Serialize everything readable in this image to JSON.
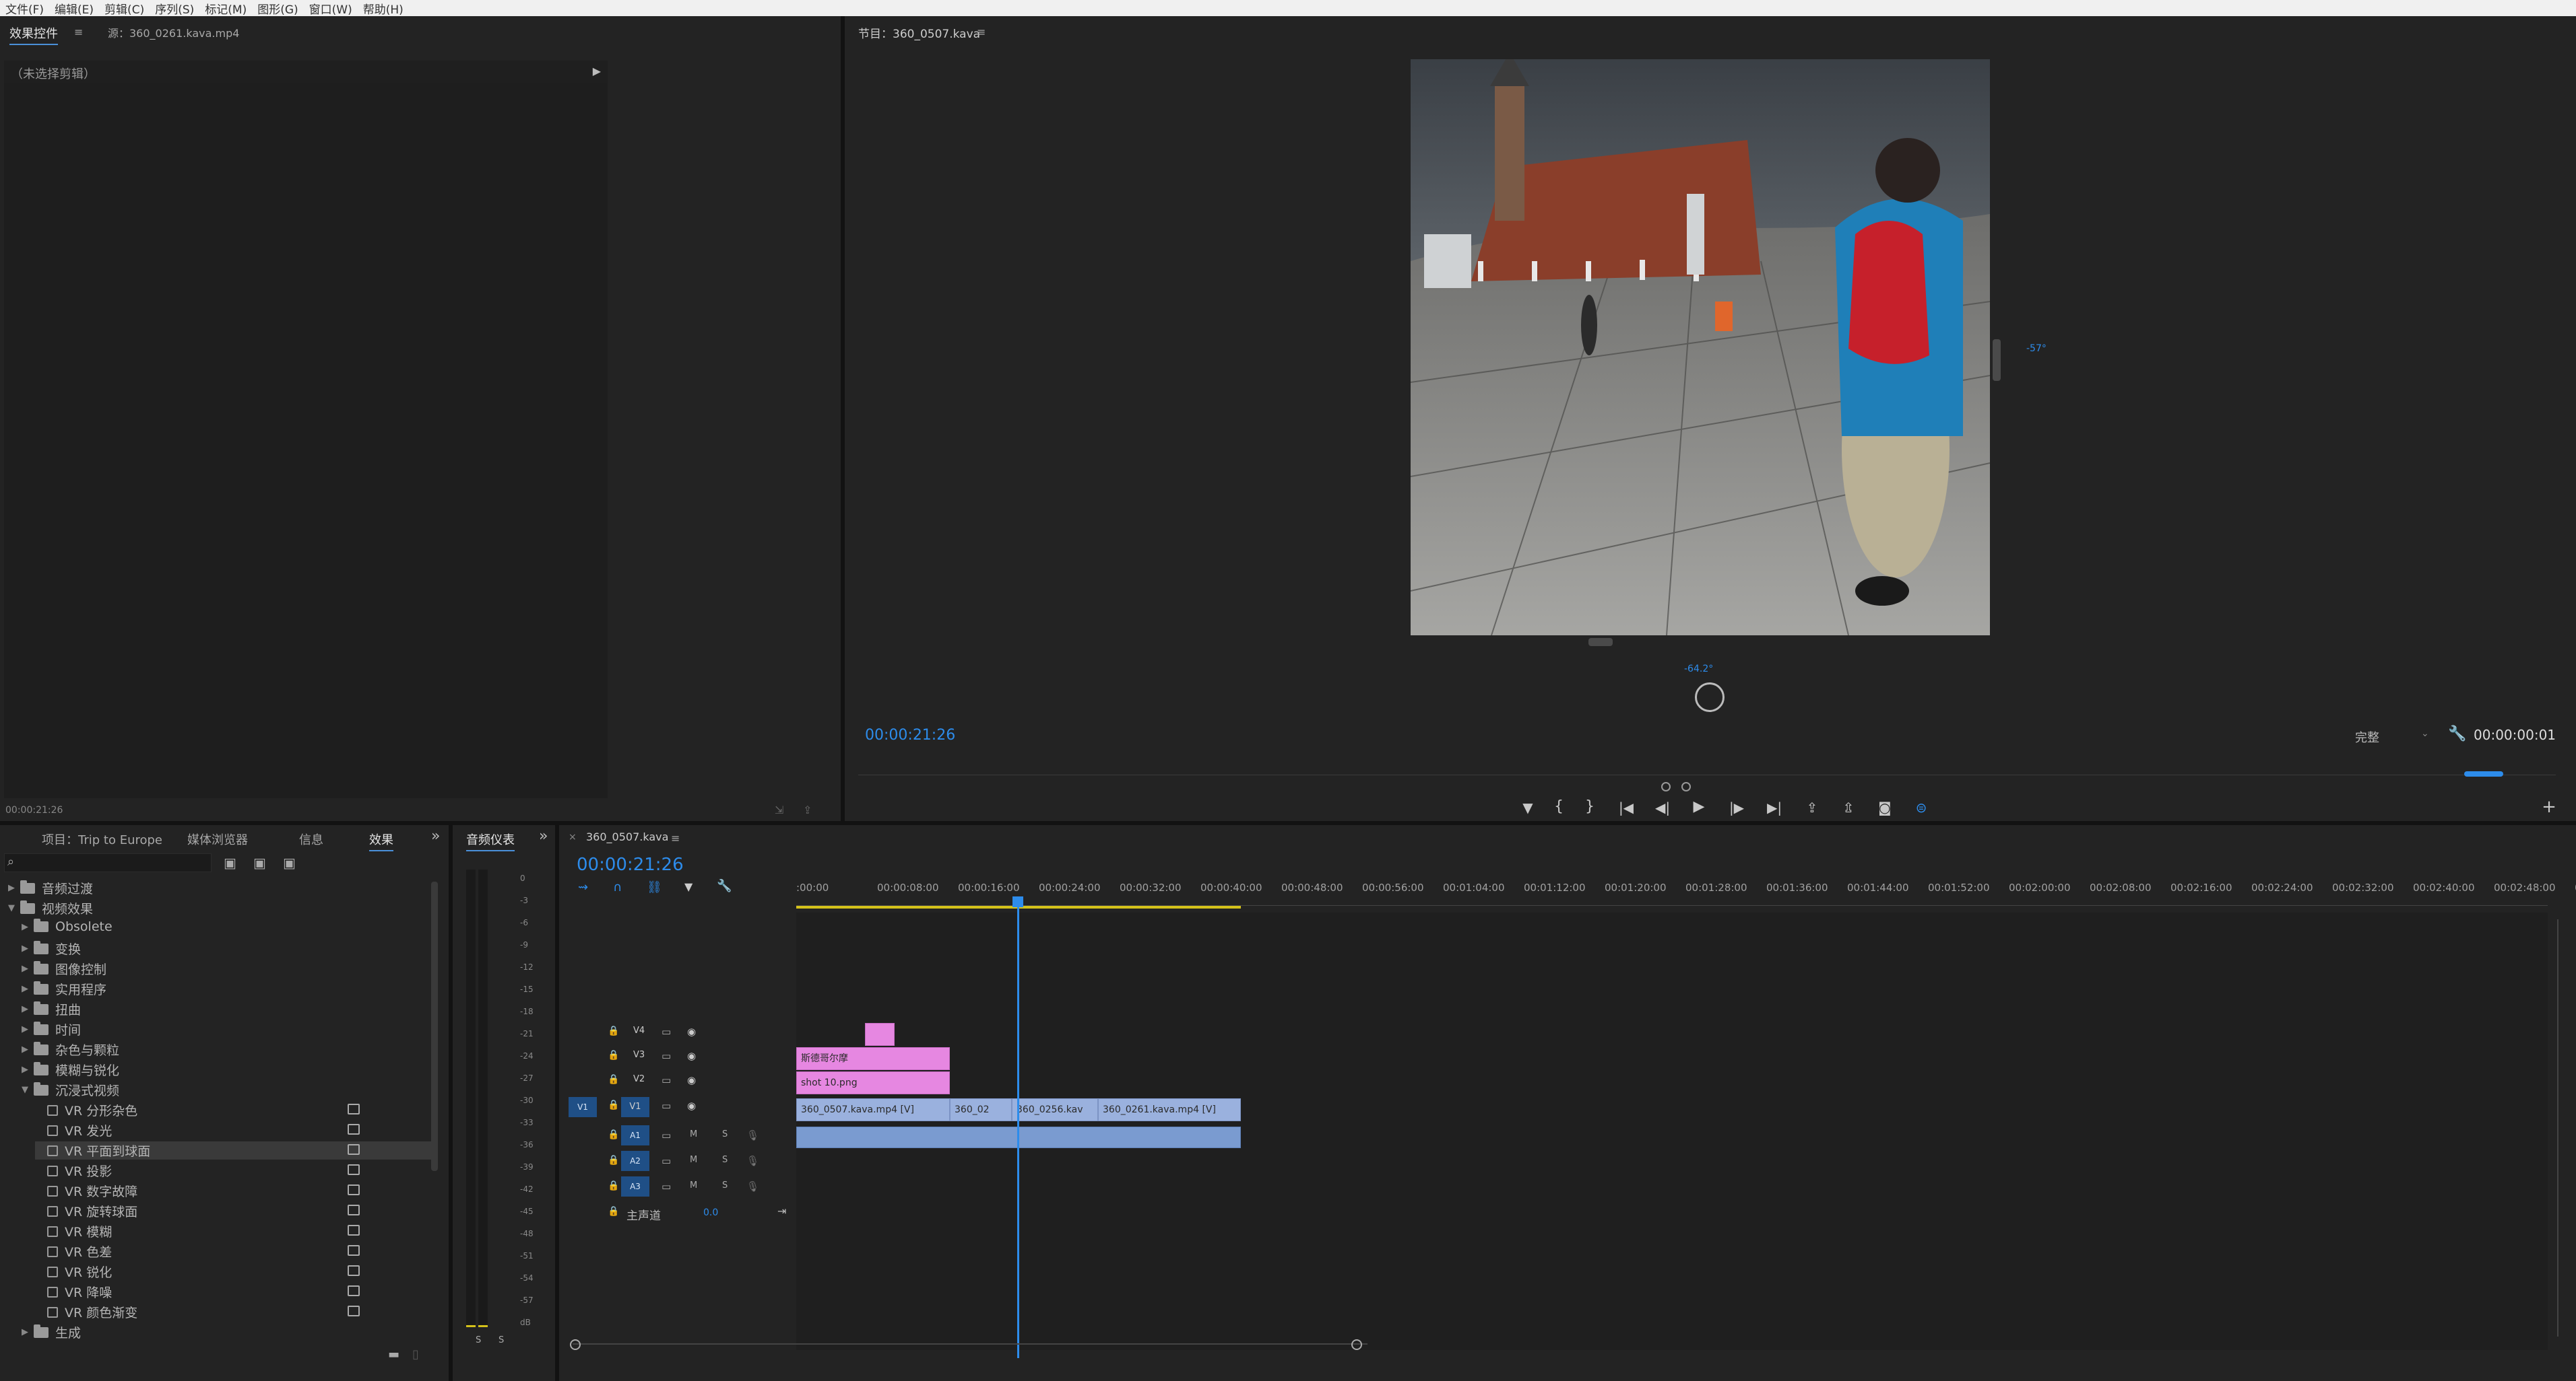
{
  "menubar": [
    "文件(F)",
    "编辑(E)",
    "剪辑(C)",
    "序列(S)",
    "标记(M)",
    "图形(G)",
    "窗口(W)",
    "帮助(H)"
  ],
  "effect_controls": {
    "tab_label": "效果控件",
    "source_tab": "源：360_0261.kava.mp4",
    "no_clip": "（未选择剪辑）",
    "timecode": "00:00:21:26"
  },
  "program": {
    "tab_label": "节目：360_0507.kava",
    "timecode": "00:00:21:26",
    "fit": "完整",
    "duration": "00:00:00:01",
    "vr_vertical": "-57°",
    "vr_horizontal": "-64.2°"
  },
  "project_panel": {
    "tabs": [
      "项目：Trip to Europe",
      "媒体浏览器",
      "信息",
      "效果"
    ],
    "active_tab": "效果",
    "tree": [
      {
        "label": "音频过渡",
        "level": 0,
        "expanded": false,
        "kind": "folder"
      },
      {
        "label": "视频效果",
        "level": 0,
        "expanded": true,
        "kind": "folder"
      },
      {
        "label": "Obsolete",
        "level": 1,
        "expanded": false,
        "kind": "folder"
      },
      {
        "label": "变换",
        "level": 1,
        "expanded": false,
        "kind": "folder"
      },
      {
        "label": "图像控制",
        "level": 1,
        "expanded": false,
        "kind": "folder"
      },
      {
        "label": "实用程序",
        "level": 1,
        "expanded": false,
        "kind": "folder"
      },
      {
        "label": "扭曲",
        "level": 1,
        "expanded": false,
        "kind": "folder"
      },
      {
        "label": "时间",
        "level": 1,
        "expanded": false,
        "kind": "folder"
      },
      {
        "label": "杂色与颗粒",
        "level": 1,
        "expanded": false,
        "kind": "folder"
      },
      {
        "label": "模糊与锐化",
        "level": 1,
        "expanded": false,
        "kind": "folder"
      },
      {
        "label": "沉浸式视频",
        "level": 1,
        "expanded": true,
        "kind": "folder"
      },
      {
        "label": "VR 分形杂色",
        "level": 2,
        "kind": "effect"
      },
      {
        "label": "VR 发光",
        "level": 2,
        "kind": "effect"
      },
      {
        "label": "VR 平面到球面",
        "level": 2,
        "kind": "effect",
        "selected": true
      },
      {
        "label": "VR 投影",
        "level": 2,
        "kind": "effect"
      },
      {
        "label": "VR 数字故障",
        "level": 2,
        "kind": "effect"
      },
      {
        "label": "VR 旋转球面",
        "level": 2,
        "kind": "effect"
      },
      {
        "label": "VR 模糊",
        "level": 2,
        "kind": "effect"
      },
      {
        "label": "VR 色差",
        "level": 2,
        "kind": "effect"
      },
      {
        "label": "VR 锐化",
        "level": 2,
        "kind": "effect"
      },
      {
        "label": "VR 降噪",
        "level": 2,
        "kind": "effect"
      },
      {
        "label": "VR 颜色渐变",
        "level": 2,
        "kind": "effect"
      },
      {
        "label": "生成",
        "level": 1,
        "expanded": false,
        "kind": "folder"
      }
    ]
  },
  "audio_meter": {
    "tab_label": "音频仪表",
    "ticks": [
      "0",
      "-3",
      "-6",
      "-9",
      "-12",
      "-15",
      "-18",
      "-21",
      "-24",
      "-27",
      "-30",
      "-33",
      "-36",
      "-39",
      "-42",
      "-45",
      "-48",
      "-51",
      "-54",
      "-57",
      "dB"
    ],
    "solo_labels": [
      "S",
      "S"
    ]
  },
  "timeline": {
    "tab_label": "360_0507.kava",
    "timecode": "00:00:21:26",
    "ruler": [
      ":00:00",
      "00:00:08:00",
      "00:00:16:00",
      "00:00:24:00",
      "00:00:32:00",
      "00:00:40:00",
      "00:00:48:00",
      "00:00:56:00",
      "00:01:04:00",
      "00:01:12:00",
      "00:01:20:00",
      "00:01:28:00",
      "00:01:36:00",
      "00:01:44:00",
      "00:01:52:00",
      "00:02:00:00",
      "00:02:08:00",
      "00:02:16:00",
      "00:02:24:00",
      "00:02:32:00",
      "00:02:40:00",
      "00:02:48:00",
      "0"
    ],
    "video_tracks": [
      "V4",
      "V3",
      "V2",
      "V1"
    ],
    "audio_tracks": [
      "A1",
      "A2",
      "A3"
    ],
    "source_patch": "V1",
    "master_label": "主声道",
    "master_value": "0.0",
    "clips": {
      "v3_title": "斯德哥尔摩",
      "v2_png": "shot 10.png",
      "v1_a": "360_0507.kava.mp4 [V]",
      "v1_b": "360_02",
      "v1_c": "360_0256.kav",
      "v1_d": "360_0261.kava.mp4 [V]"
    },
    "track_letters": {
      "mute": "M",
      "solo": "S"
    }
  },
  "colors": {
    "accent": "#2d8ceb",
    "clip_video": "#9ab1de",
    "clip_graphic": "#e687e1",
    "clip_audio": "#7a9bd0",
    "work_area": "#d4c21a"
  }
}
